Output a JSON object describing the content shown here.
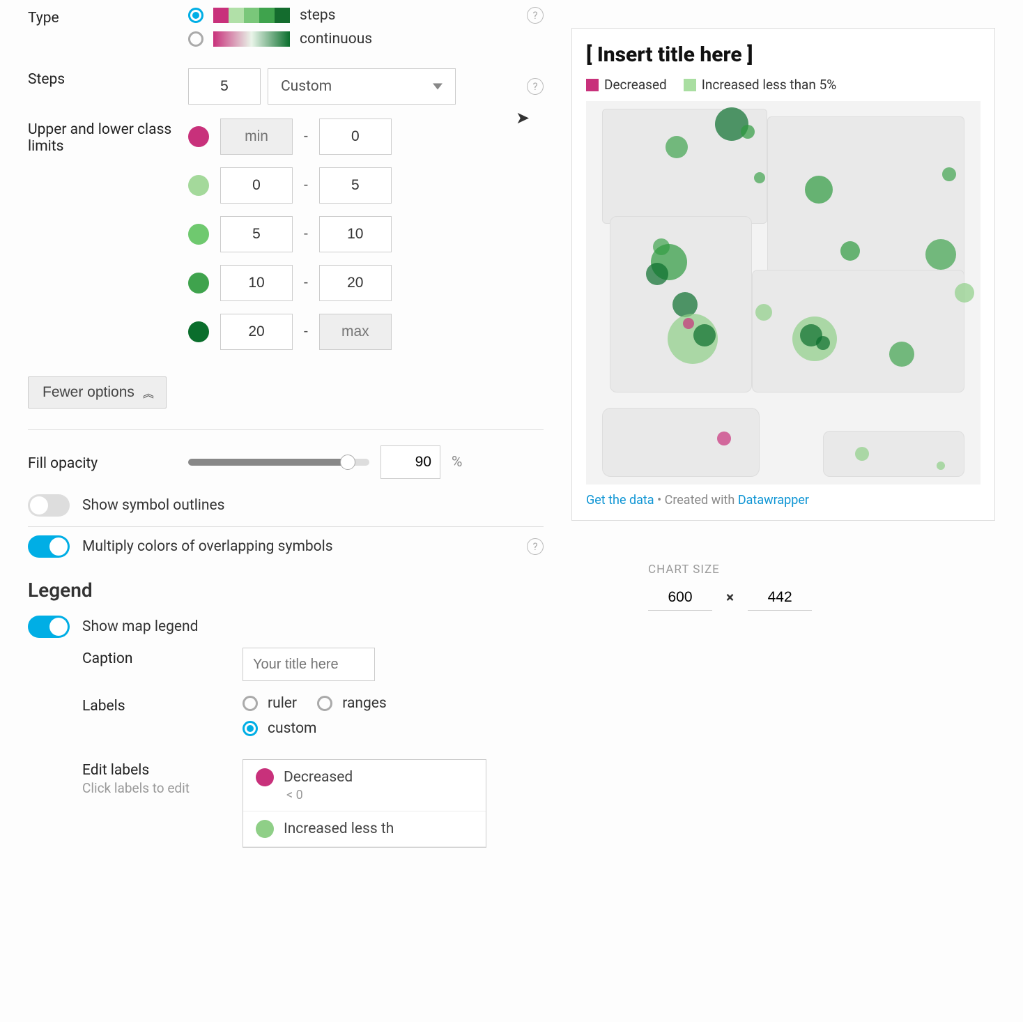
{
  "type": {
    "label": "Type",
    "options": {
      "steps": "steps",
      "continuous": "continuous"
    },
    "selected": "steps",
    "palette_steps": [
      "#c8317b",
      "#b1e0a8",
      "#7ac77a",
      "#3fa34d",
      "#146c2e"
    ]
  },
  "steps": {
    "label": "Steps",
    "count": "5",
    "mode": "Custom"
  },
  "limits": {
    "label": "Upper and lower class limits",
    "min_placeholder": "min",
    "max_placeholder": "max",
    "dash": "-",
    "rows": [
      {
        "color": "#c8317b",
        "lo": "",
        "hi": "0",
        "lo_disabled": true
      },
      {
        "color": "#a4d99b",
        "lo": "0",
        "hi": "5"
      },
      {
        "color": "#6fc96f",
        "lo": "5",
        "hi": "10"
      },
      {
        "color": "#3fa34d",
        "lo": "10",
        "hi": "20"
      },
      {
        "color": "#0a6e2c",
        "lo": "20",
        "hi": "",
        "hi_disabled": true
      }
    ]
  },
  "fewer_options": "Fewer options",
  "fill_opacity": {
    "label": "Fill opacity",
    "value": "90",
    "unit": "%"
  },
  "toggles": {
    "outlines": {
      "label": "Show symbol outlines",
      "on": false
    },
    "multiply": {
      "label": "Multiply colors of overlapping symbols",
      "on": true
    }
  },
  "legend": {
    "heading": "Legend",
    "show": {
      "label": "Show map legend",
      "on": true
    },
    "caption": {
      "label": "Caption",
      "placeholder": "Your title here"
    },
    "labels": {
      "label": "Labels",
      "options": {
        "ruler": "ruler",
        "ranges": "ranges",
        "custom": "custom"
      },
      "selected": "custom"
    },
    "edit": {
      "label": "Edit labels",
      "hint": "Click labels to edit",
      "items": [
        {
          "color": "#c8317b",
          "text": "Decreased",
          "sub": "< 0"
        },
        {
          "color": "#8fcf87",
          "text": "Increased less th"
        }
      ]
    }
  },
  "preview": {
    "title": "[ Insert title here ]",
    "chips": [
      {
        "color": "#c8317b",
        "text": "Decreased"
      },
      {
        "color": "#a9dea1",
        "text": "Increased less than 5%"
      }
    ],
    "footer": {
      "get_data": "Get the data",
      "created": "Created with",
      "brand": "Datawrapper"
    },
    "bubbles": [
      {
        "x": 37,
        "y": 6,
        "r": 24,
        "c": "#0a6e2c"
      },
      {
        "x": 41,
        "y": 8,
        "r": 10,
        "c": "#2e9a3f"
      },
      {
        "x": 23,
        "y": 12,
        "r": 16,
        "c": "#3fa34d"
      },
      {
        "x": 44,
        "y": 20,
        "r": 8,
        "c": "#3fa34d"
      },
      {
        "x": 59,
        "y": 23,
        "r": 20,
        "c": "#2e9a3f"
      },
      {
        "x": 92,
        "y": 19,
        "r": 10,
        "c": "#3fa34d"
      },
      {
        "x": 19,
        "y": 38,
        "r": 12,
        "c": "#3fa34d"
      },
      {
        "x": 21,
        "y": 42,
        "r": 26,
        "c": "#2e9a3f"
      },
      {
        "x": 18,
        "y": 45,
        "r": 16,
        "c": "#0a6e2c"
      },
      {
        "x": 67,
        "y": 39,
        "r": 14,
        "c": "#2e9a3f"
      },
      {
        "x": 90,
        "y": 40,
        "r": 22,
        "c": "#3fa34d"
      },
      {
        "x": 25,
        "y": 53,
        "r": 18,
        "c": "#0a6e2c"
      },
      {
        "x": 27,
        "y": 62,
        "r": 36,
        "c": "#8fcf87"
      },
      {
        "x": 30,
        "y": 61,
        "r": 16,
        "c": "#0a6e2c"
      },
      {
        "x": 26,
        "y": 58,
        "r": 8,
        "c": "#c8317b"
      },
      {
        "x": 45,
        "y": 55,
        "r": 12,
        "c": "#8fcf87"
      },
      {
        "x": 58,
        "y": 62,
        "r": 32,
        "c": "#8fcf87"
      },
      {
        "x": 57,
        "y": 61,
        "r": 16,
        "c": "#0a6e2c"
      },
      {
        "x": 60,
        "y": 63,
        "r": 10,
        "c": "#0a6e2c"
      },
      {
        "x": 80,
        "y": 66,
        "r": 18,
        "c": "#3fa34d"
      },
      {
        "x": 96,
        "y": 50,
        "r": 14,
        "c": "#8fcf87"
      },
      {
        "x": 35,
        "y": 88,
        "r": 10,
        "c": "#c8317b"
      },
      {
        "x": 70,
        "y": 92,
        "r": 10,
        "c": "#8fcf87"
      },
      {
        "x": 90,
        "y": 95,
        "r": 6,
        "c": "#8fcf87"
      }
    ]
  },
  "chart_size": {
    "label": "CHART SIZE",
    "w": "600",
    "h": "442",
    "x": "×"
  }
}
